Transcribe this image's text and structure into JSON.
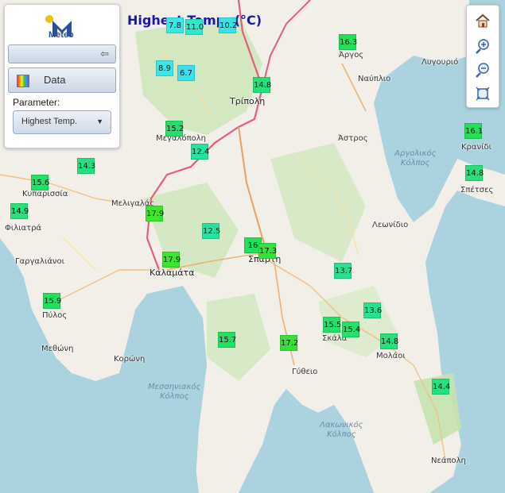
{
  "title": "Highest Temp. (°C)",
  "panel": {
    "logo_text": "Meteo",
    "collapse_icon": "arrow-left-icon",
    "data_button_label": "Data",
    "parameter_label": "Parameter:",
    "parameter_value": "Highest Temp."
  },
  "toolbar": {
    "home_icon": "home-icon",
    "zoom_in_icon": "zoom-in-icon",
    "zoom_out_icon": "zoom-out-icon",
    "extent_icon": "full-extent-icon"
  },
  "places": {
    "argos": "Άργος",
    "nafplio": "Ναύπλιο",
    "lygourio": "Λυγουριό",
    "tripoli": "Τρίπολη",
    "megalopoli": "Μεγαλόπολη",
    "astros": "Άστρος",
    "kranidi": "Κρανίδι",
    "spetses": "Σπέτσες",
    "kyparissia": "Κυπαρισσία",
    "meligalas": "Μελιγαλάς",
    "filiatra": "Φιλιατρά",
    "gargalianoi": "Γαργαλιάνοι",
    "kalamata": "Καλαμάτα",
    "sparti": "Σπάρτη",
    "leonidio": "Λεωνίδιο",
    "pylos": "Πύλος",
    "methoni": "Μεθώνη",
    "koroni": "Κορώνη",
    "skala": "Σκάλα",
    "molaoi": "Μολάοι",
    "gytheio": "Γύθειο",
    "neapoli": "Νεάπολη"
  },
  "seas": {
    "argolikos": "Αργολικός\nΚόλπος",
    "messiniakos": "Μεσσηνιακός\nΚόλπος",
    "lakonikos": "Λακωνικός\nΚόλπος"
  },
  "stations": [
    {
      "value": "7.8",
      "color": "#38e8e8"
    },
    {
      "value": "11.0",
      "color": "#2ee8c8"
    },
    {
      "value": "10.2",
      "color": "#38e0e8"
    },
    {
      "value": "8.9",
      "color": "#38e8e8"
    },
    {
      "value": "6.7",
      "color": "#38e0f0"
    },
    {
      "value": "16.3",
      "color": "#22e058"
    },
    {
      "value": "14.8",
      "color": "#26e07a"
    },
    {
      "value": "15.2",
      "color": "#22e068"
    },
    {
      "value": "12.4",
      "color": "#28e0a0"
    },
    {
      "value": "16.1",
      "color": "#22e058"
    },
    {
      "value": "14.8",
      "color": "#26e07a"
    },
    {
      "value": "14.3",
      "color": "#26e080"
    },
    {
      "value": "15.6",
      "color": "#22e068"
    },
    {
      "value": "14.9",
      "color": "#26e07a"
    },
    {
      "value": "17.9",
      "color": "#3ee430"
    },
    {
      "value": "12.5",
      "color": "#28e0a0"
    },
    {
      "value": "16",
      "color": "#22e058"
    },
    {
      "value": "17.3",
      "color": "#36e23a"
    },
    {
      "value": "17.9",
      "color": "#3ee430"
    },
    {
      "value": "13.7",
      "color": "#28e090"
    },
    {
      "value": "15.9",
      "color": "#22e060"
    },
    {
      "value": "13.6",
      "color": "#28e090"
    },
    {
      "value": "15.5",
      "color": "#22e068"
    },
    {
      "value": "15.4",
      "color": "#22e068"
    },
    {
      "value": "14.8",
      "color": "#26e07a"
    },
    {
      "value": "15.7",
      "color": "#22e060"
    },
    {
      "value": "17.2",
      "color": "#36e23a"
    },
    {
      "value": "14.4",
      "color": "#26e080"
    }
  ]
}
